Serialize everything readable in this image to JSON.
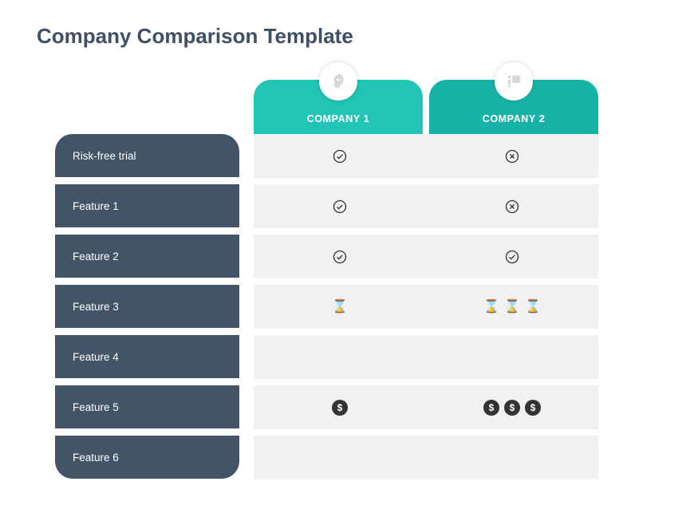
{
  "title": "Company Comparison Template",
  "companies": [
    {
      "label": "COMPANY 1",
      "badge_icon": "head-gear-icon"
    },
    {
      "label": "COMPANY 2",
      "badge_icon": "presenter-icon"
    }
  ],
  "rows": [
    {
      "label": "Risk-free trial",
      "c1": {
        "type": "check"
      },
      "c2": {
        "type": "cross"
      }
    },
    {
      "label": "Feature 1",
      "c1": {
        "type": "check"
      },
      "c2": {
        "type": "cross"
      }
    },
    {
      "label": "Feature 2",
      "c1": {
        "type": "check"
      },
      "c2": {
        "type": "check"
      }
    },
    {
      "label": "Feature 3",
      "c1": {
        "type": "hour",
        "count": 1
      },
      "c2": {
        "type": "hour",
        "count": 3
      }
    },
    {
      "label": "Feature 4",
      "c1": {
        "type": "empty"
      },
      "c2": {
        "type": "empty"
      }
    },
    {
      "label": "Feature 5",
      "c1": {
        "type": "dollar",
        "count": 1
      },
      "c2": {
        "type": "dollar",
        "count": 3
      }
    },
    {
      "label": "Feature 6",
      "c1": {
        "type": "empty"
      },
      "c2": {
        "type": "empty"
      }
    }
  ],
  "chart_data": {
    "type": "table",
    "title": "Company Comparison Template",
    "columns": [
      "COMPANY 1",
      "COMPANY 2"
    ],
    "row_labels": [
      "Risk-free trial",
      "Feature 1",
      "Feature 2",
      "Feature 3",
      "Feature 4",
      "Feature 5",
      "Feature 6"
    ],
    "values": [
      [
        "yes",
        "no"
      ],
      [
        "yes",
        "no"
      ],
      [
        "yes",
        "yes"
      ],
      [
        "hourglass×1",
        "hourglass×3"
      ],
      [
        "",
        ""
      ],
      [
        "$×1",
        "$×3"
      ],
      [
        "",
        ""
      ]
    ]
  }
}
